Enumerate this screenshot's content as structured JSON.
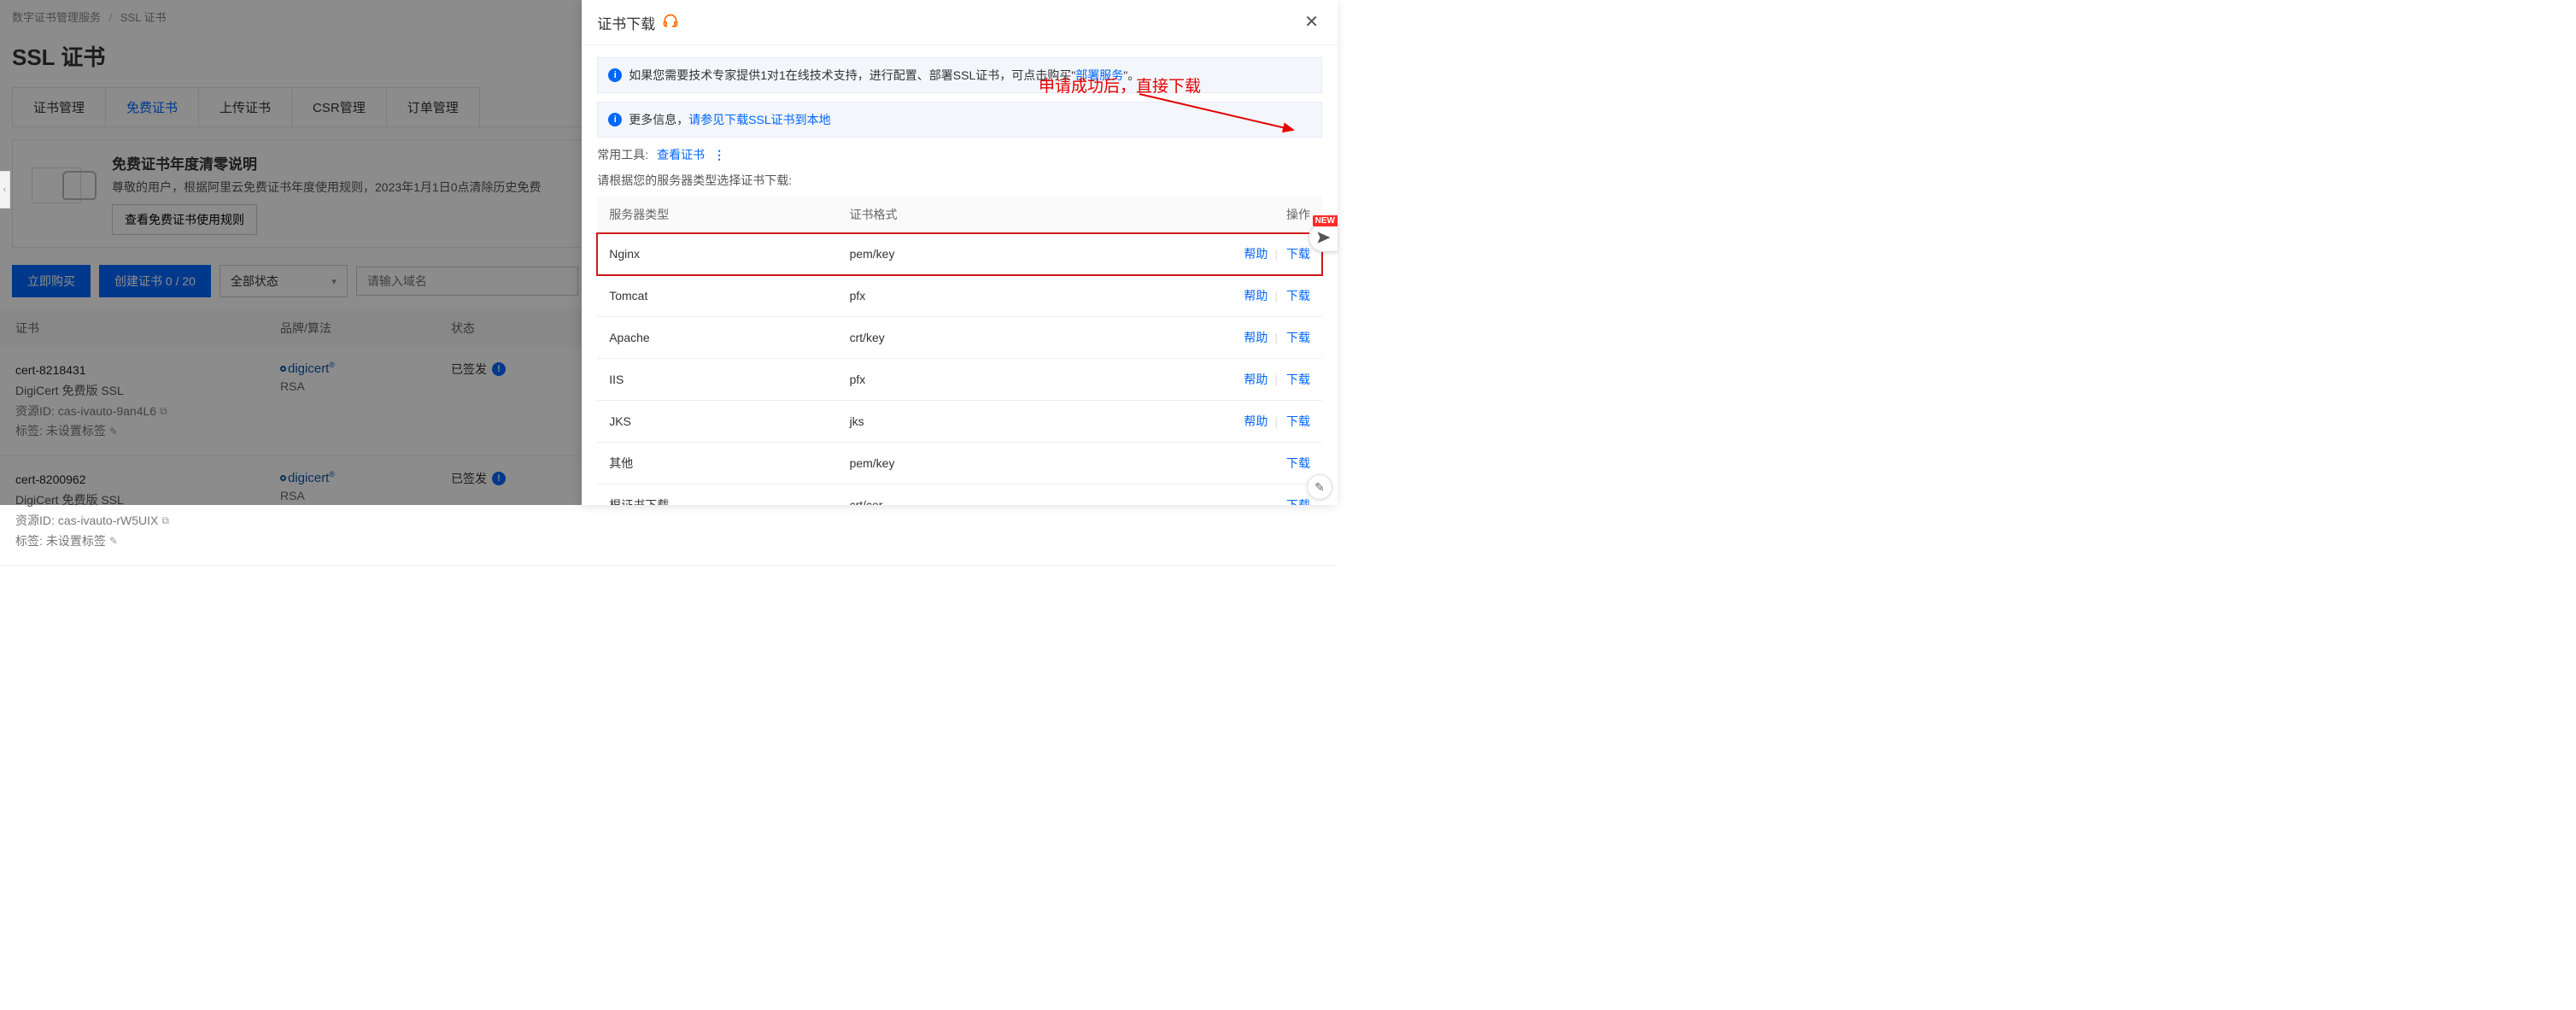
{
  "breadcrumb": {
    "root": "数字证书管理服务",
    "current": "SSL 证书"
  },
  "page_title": "SSL 证书",
  "tabs": [
    {
      "label": "证书管理"
    },
    {
      "label": "免费证书",
      "active": true
    },
    {
      "label": "上传证书"
    },
    {
      "label": "CSR管理"
    },
    {
      "label": "订单管理"
    }
  ],
  "notice": {
    "title": "免费证书年度清零说明",
    "desc": "尊敬的用户，根据阿里云免费证书年度使用规则，2023年1月1日0点清除历史免费",
    "button": "查看免费证书使用规则"
  },
  "actions": {
    "buy": "立即购买",
    "create": "创建证书 0 / 20",
    "status_select": "全部状态",
    "search_placeholder": "请输入域名"
  },
  "cert_table": {
    "headers": {
      "cert": "证书",
      "brand": "品牌/算法",
      "status": "状态"
    },
    "rows": [
      {
        "name": "cert-8218431",
        "product": "DigiCert 免费版 SSL",
        "resource_label": "资源ID:",
        "resource_id": "cas-ivauto-9an4L6",
        "tag_label": "标签:",
        "tag_value": "未设置标签",
        "brand": "digicert",
        "algo": "RSA",
        "status": "已签发"
      },
      {
        "name": "cert-8200962",
        "product": "DigiCert 免费版 SSL",
        "resource_label": "资源ID:",
        "resource_id": "cas-ivauto-rW5UIX",
        "tag_label": "标签:",
        "tag_value": "未设置标签",
        "brand": "digicert",
        "algo": "RSA",
        "status": "已签发"
      }
    ]
  },
  "drawer": {
    "title": "证书下载",
    "alert1_prefix": "如果您需要技术专家提供1对1在线技术支持，进行配置、部署SSL证书，可点击购买\"",
    "alert1_link": "部署服务",
    "alert1_suffix": "\"。",
    "alert2_prefix": "更多信息，",
    "alert2_link": "请参见下载SSL证书到本地",
    "tools_label": "常用工具:",
    "tools_link": "查看证书",
    "hint": "请根据您的服务器类型选择证书下载:",
    "headers": {
      "server": "服务器类型",
      "format": "证书格式",
      "op": "操作"
    },
    "help_label": "帮助",
    "download_label": "下载",
    "rows": [
      {
        "server": "Nginx",
        "format": "pem/key",
        "highlight": true,
        "help": true
      },
      {
        "server": "Tomcat",
        "format": "pfx",
        "help": true
      },
      {
        "server": "Apache",
        "format": "crt/key",
        "help": true
      },
      {
        "server": "IIS",
        "format": "pfx",
        "help": true
      },
      {
        "server": "JKS",
        "format": "jks",
        "help": true
      },
      {
        "server": "其他",
        "format": "pem/key",
        "help": false
      },
      {
        "server": "根证书下载",
        "format": "crt/cer",
        "help": false
      }
    ]
  },
  "annotation": "申请成功后，直接下载",
  "new_badge": "NEW"
}
